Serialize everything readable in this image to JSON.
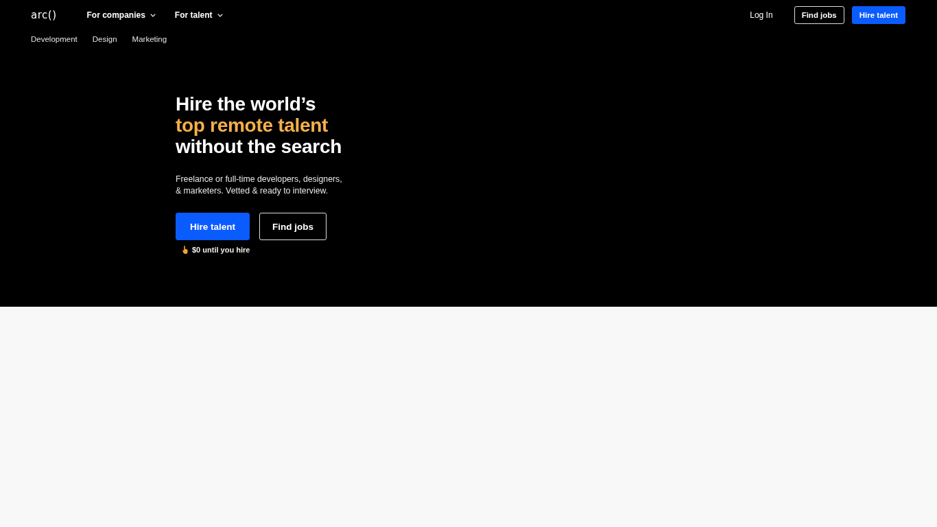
{
  "nav": {
    "logo": "arc()",
    "menus": [
      {
        "label": "For companies"
      },
      {
        "label": "For talent"
      }
    ],
    "login": "Log In",
    "buttons": [
      {
        "label": "Find jobs",
        "kind": "outline"
      },
      {
        "label": "Hire talent",
        "kind": "primary"
      }
    ]
  },
  "subnav": [
    "Development",
    "Design",
    "Marketing"
  ],
  "hero": {
    "heading_lines": [
      {
        "text": "Hire the world’s",
        "highlighted": false
      },
      {
        "text": "top remote talent",
        "highlighted": true
      },
      {
        "text": "without the search",
        "highlighted": false
      }
    ],
    "description": "Freelance or full-time developers, designers, & marketers. Vetted & ready to interview.",
    "buttons": [
      {
        "label": "Hire talent",
        "kind": "primary"
      },
      {
        "label": "Find jobs",
        "kind": "outline"
      }
    ],
    "note": "$0 until you hire"
  }
}
